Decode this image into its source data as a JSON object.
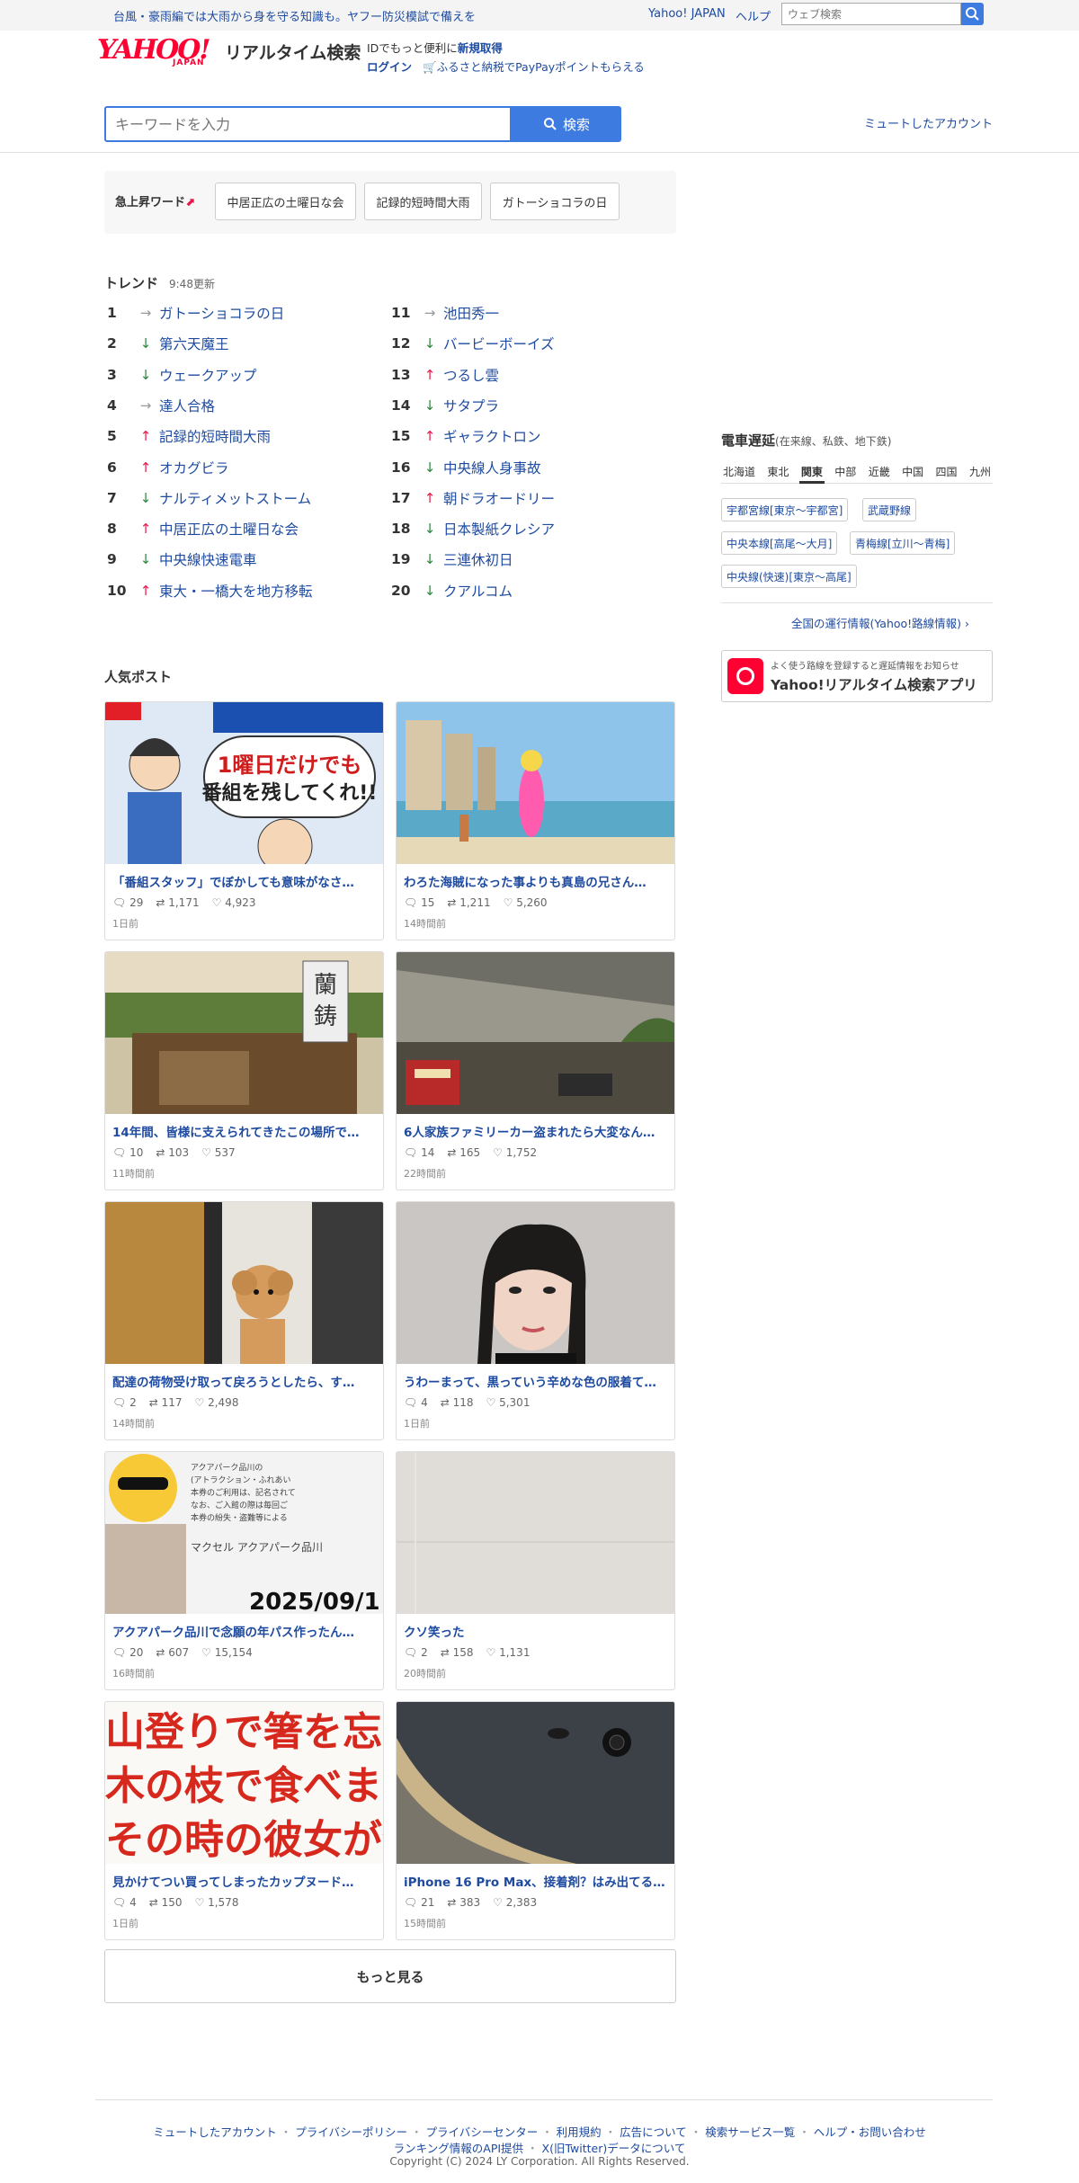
{
  "topbar": {
    "notice": "台風・豪雨編では大雨から身を守る知識も。ヤフー防災模試で備えを",
    "yahoo_japan": "Yahoo! JAPAN",
    "help": "ヘルプ",
    "web_search_placeholder": "ウェブ検索"
  },
  "header": {
    "logo_text": "YAHOO!",
    "logo_sub": "JAPAN",
    "service_title": "リアルタイム検索",
    "id_prefix": "IDでもっと便利に",
    "id_register": "新規取得",
    "login": "ログイン",
    "furusato": "ふるさと納税でPayPayポイントもらえる"
  },
  "search": {
    "placeholder": "キーワードを入力",
    "button": "検索",
    "muted_accounts": "ミュートしたアカウント"
  },
  "rising": {
    "label": "急上昇ワード",
    "chips": [
      "中居正広の土曜日な会",
      "記録的短時間大雨",
      "ガトーショコラの日"
    ]
  },
  "trend": {
    "title": "トレンド",
    "updated": "9:48更新",
    "items": [
      {
        "rank": "1",
        "dir": "flat",
        "text": "ガトーショコラの日"
      },
      {
        "rank": "2",
        "dir": "down",
        "text": "第六天魔王"
      },
      {
        "rank": "3",
        "dir": "down",
        "text": "ウェークアップ"
      },
      {
        "rank": "4",
        "dir": "flat",
        "text": "達人合格"
      },
      {
        "rank": "5",
        "dir": "up",
        "text": "記録的短時間大雨"
      },
      {
        "rank": "6",
        "dir": "up",
        "text": "オカグビラ"
      },
      {
        "rank": "7",
        "dir": "down",
        "text": "ナルティメットストーム"
      },
      {
        "rank": "8",
        "dir": "up",
        "text": "中居正広の土曜日な会"
      },
      {
        "rank": "9",
        "dir": "down",
        "text": "中央線快速電車"
      },
      {
        "rank": "10",
        "dir": "up",
        "text": "東大・一橋大を地方移転"
      },
      {
        "rank": "11",
        "dir": "flat",
        "text": "池田秀一"
      },
      {
        "rank": "12",
        "dir": "down",
        "text": "バービーボーイズ"
      },
      {
        "rank": "13",
        "dir": "up",
        "text": "つるし雲"
      },
      {
        "rank": "14",
        "dir": "down",
        "text": "サタプラ"
      },
      {
        "rank": "15",
        "dir": "up",
        "text": "ギャラクトロン"
      },
      {
        "rank": "16",
        "dir": "down",
        "text": "中央線人身事故"
      },
      {
        "rank": "17",
        "dir": "up",
        "text": "朝ドラオードリー"
      },
      {
        "rank": "18",
        "dir": "down",
        "text": "日本製紙クレシア"
      },
      {
        "rank": "19",
        "dir": "down",
        "text": "三連休初日"
      },
      {
        "rank": "20",
        "dir": "down",
        "text": "クアルコム"
      }
    ]
  },
  "train": {
    "title": "電車遅延",
    "subtitle": "(在来線、私鉄、地下鉄)",
    "regions": [
      "北海道",
      "東北",
      "関東",
      "中部",
      "近畿",
      "中国",
      "四国",
      "九州"
    ],
    "active_region": "関東",
    "lines": [
      "宇都宮線[東京〜宇都宮]",
      "武蔵野線",
      "中央本線[高尾〜大月]",
      "青梅線[立川〜青梅]",
      "中央線(快速)[東京〜高尾]"
    ],
    "all_info": "全国の運行情報(Yahoo!路線情報)"
  },
  "app_banner": {
    "sub": "よく使う路線を登録すると遅延情報をお知らせ",
    "title": "Yahoo!リアルタイム検索アプリ"
  },
  "posts": {
    "title": "人気ポスト",
    "items": [
      {
        "title": "「番組スタッフ」でぼかしても意味がなさ…",
        "replies": "29",
        "reposts": "1,171",
        "likes": "4,923",
        "time": "1日前",
        "image": "tv-comic"
      },
      {
        "title": "わろた海賊になった事よりも真島の兄さん…",
        "replies": "15",
        "reposts": "1,211",
        "likes": "5,260",
        "time": "14時間前",
        "image": "beach"
      },
      {
        "title": "14年間、皆様に支えられてきたこの場所で…",
        "replies": "10",
        "reposts": "103",
        "likes": "537",
        "time": "11時間前",
        "image": "shop"
      },
      {
        "title": "6人家族ファミリーカー盗まれたら大変なん…",
        "replies": "14",
        "reposts": "165",
        "likes": "1,752",
        "time": "22時間前",
        "image": "wall"
      },
      {
        "title": "配達の荷物受け取って戻ろうとしたら、す…",
        "replies": "2",
        "reposts": "117",
        "likes": "2,498",
        "time": "14時間前",
        "image": "dog"
      },
      {
        "title": "うわーまって、黒っていう辛めな色の服着て…",
        "replies": "4",
        "reposts": "118",
        "likes": "5,301",
        "time": "1日前",
        "image": "portrait"
      },
      {
        "title": "アクアパーク品川で念願の年パス作ったん…",
        "replies": "20",
        "reposts": "607",
        "likes": "15,154",
        "time": "16時間前",
        "image": "card"
      },
      {
        "title": "クソ笑った",
        "replies": "2",
        "reposts": "158",
        "likes": "1,131",
        "time": "20時間前",
        "image": "paper"
      },
      {
        "title": "見かけてつい買ってしまったカップヌード…",
        "replies": "4",
        "reposts": "150",
        "likes": "1,578",
        "time": "1日前",
        "image": "noodle"
      },
      {
        "title": "iPhone 16 Pro Max、接着剤？はみ出てる…",
        "replies": "21",
        "reposts": "383",
        "likes": "2,383",
        "time": "15時間前",
        "image": "phone"
      }
    ],
    "more": "もっと見る"
  },
  "footer": {
    "row1": [
      "ミュートしたアカウント",
      "プライバシーポリシー",
      "プライバシーセンター",
      "利用規約",
      "広告について",
      "検索サービス一覧",
      "ヘルプ・お問い合わせ"
    ],
    "row2": [
      "ランキング情報のAPI提供",
      "X(旧Twitter)データについて"
    ],
    "copyright": "Copyright (C) 2024 LY Corporation. All Rights Reserved."
  }
}
